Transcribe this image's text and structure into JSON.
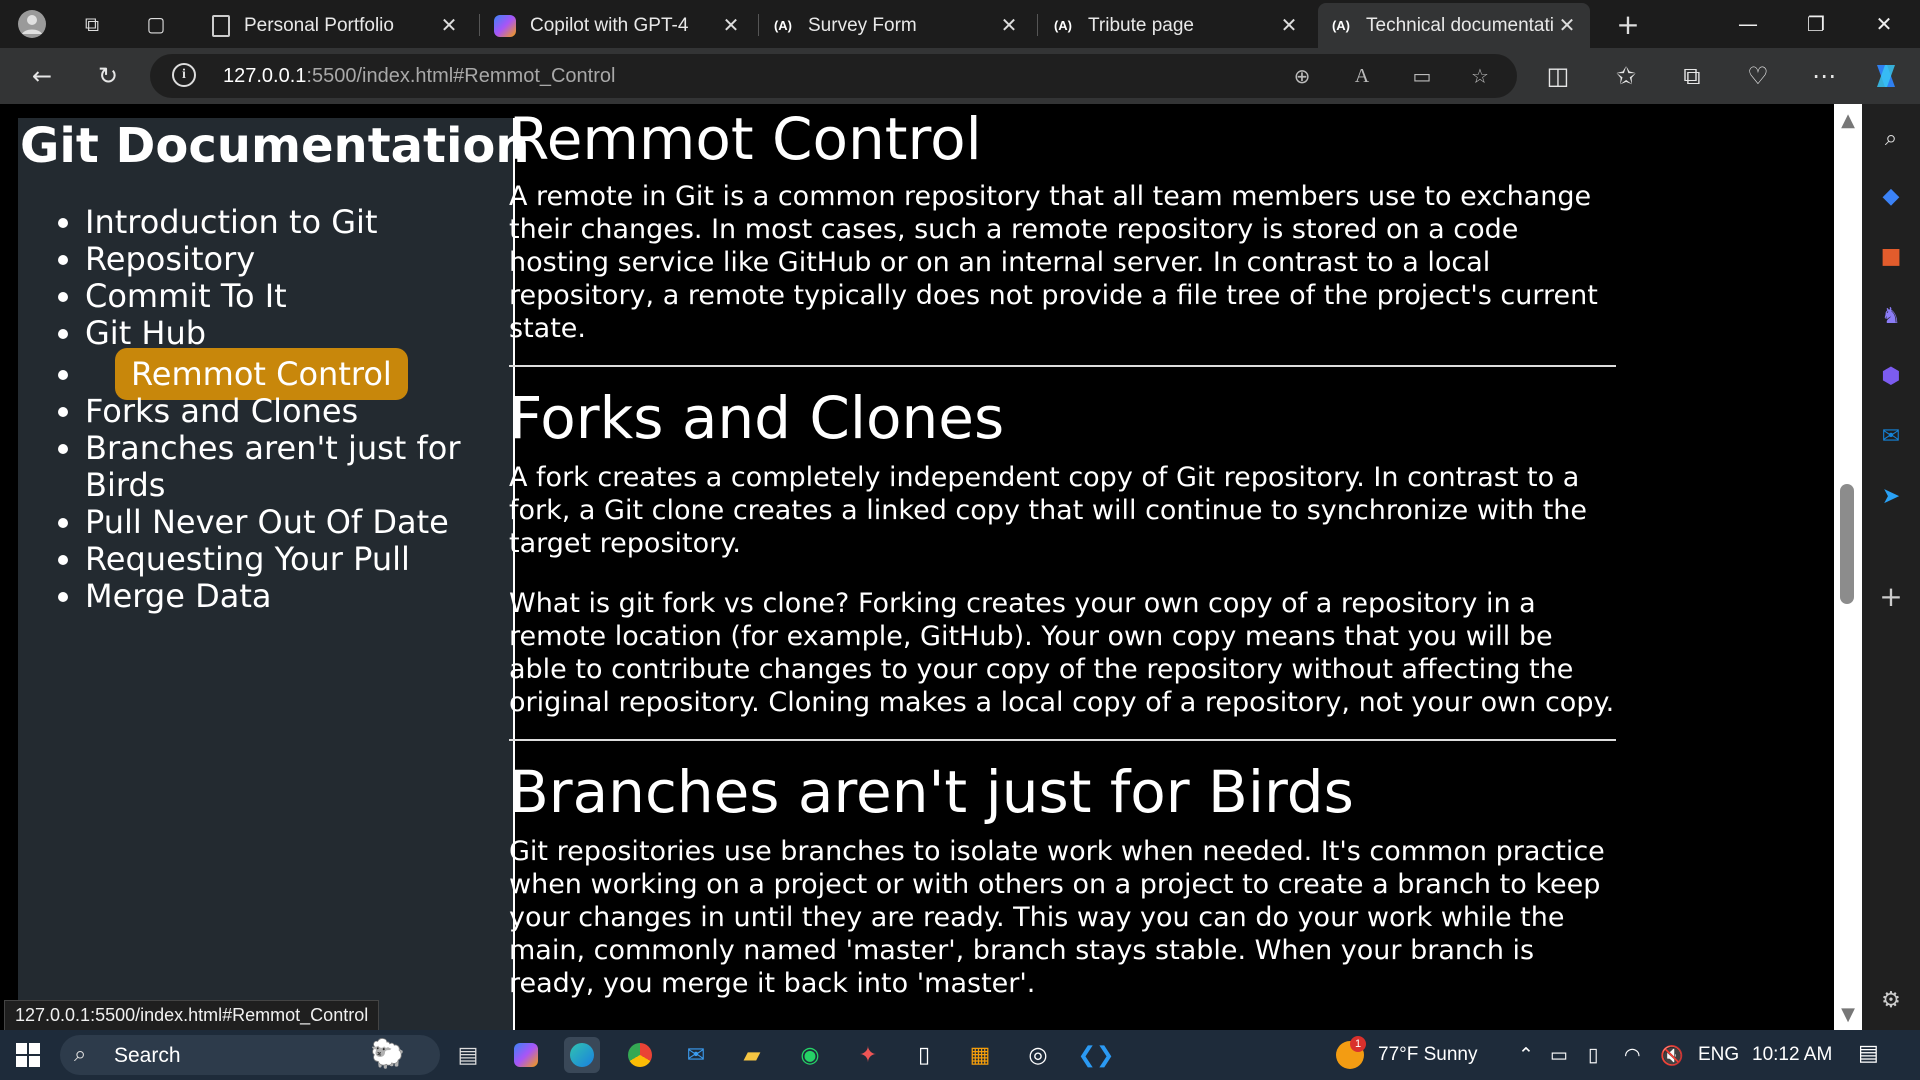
{
  "browser": {
    "tabs": [
      {
        "title": "Personal Portfolio",
        "icon": "page-icon"
      },
      {
        "title": "Copilot with GPT-4",
        "icon": "copilot-icon"
      },
      {
        "title": "Survey Form",
        "icon": "angular-icon"
      },
      {
        "title": "Tribute page",
        "icon": "angular-icon"
      },
      {
        "title": "Technical documentati",
        "icon": "angular-icon"
      }
    ],
    "url_host": "127.0.0.1",
    "url_rest": ":5500/index.html#Remmot_Control",
    "status_url": "127.0.0.1:5500/index.html#Remmot_Control"
  },
  "sidenav": {
    "title": "Git Documentation",
    "items": [
      "Introduction to Git",
      "Repository",
      "Commit To It",
      "Git Hub",
      "Remmot Control",
      "Forks and Clones",
      "Branches aren't just for Birds",
      "Pull Never Out Of Date",
      "Requesting Your Pull",
      "Merge Data"
    ],
    "highlight_color": "#c8870b"
  },
  "main": {
    "sections": [
      {
        "heading": "Remmot Control",
        "paragraphs": [
          "A remote in Git is a common repository that all team members use to exchange their changes. In most cases, such a remote repository is stored on a code hosting service like GitHub or on an internal server. In contrast to a local repository, a remote typically does not provide a file tree of the project's current state."
        ]
      },
      {
        "heading": "Forks and Clones",
        "paragraphs": [
          "A fork creates a completely independent copy of Git repository. In contrast to a fork, a Git clone creates a linked copy that will continue to synchronize with the target repository.",
          "What is git fork vs clone? Forking creates your own copy of a repository in a remote location (for example, GitHub). Your own copy means that you will be able to contribute changes to your copy of the repository without affecting the original repository. Cloning makes a local copy of a repository, not your own copy."
        ]
      },
      {
        "heading": "Branches aren't just for Birds",
        "paragraphs": [
          "Git repositories use branches to isolate work when needed. It's common practice when working on a project or with others on a project to create a branch to keep your changes in until they are ready. This way you can do your work while the main, commonly named 'master', branch stays stable. When your branch is ready, you merge it back into 'master'."
        ]
      }
    ]
  },
  "taskbar": {
    "search_label": "Search",
    "weather": "77°F Sunny",
    "weather_badge": "1",
    "language": "ENG",
    "time": "10:12 AM"
  }
}
